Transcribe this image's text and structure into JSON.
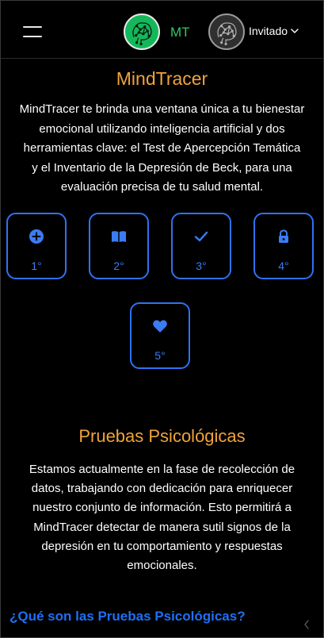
{
  "header": {
    "brand_abbr": "MT",
    "user_label": "Invitado",
    "icons": {
      "menu": "hamburger-icon",
      "brand_logo": "brain-circuit-logo",
      "user_avatar": "brain-circuit-avatar",
      "user_dropdown": "chevron-down-icon"
    }
  },
  "hero": {
    "title": "MindTracer",
    "description": "MindTracer te brinda una ventana única a tu bienestar emocional utilizando inteligencia artificial y dos herramientas clave: el Test de Apercepción Temática y el Inventario de la Depresión de Beck, para una evaluación precisa de tu salud mental."
  },
  "steps": [
    {
      "label": "1°",
      "icon": "plus-circle-icon"
    },
    {
      "label": "2°",
      "icon": "book-open-icon"
    },
    {
      "label": "3°",
      "icon": "check-icon"
    },
    {
      "label": "4°",
      "icon": "lock-icon"
    },
    {
      "label": "5°",
      "icon": "heart-icon"
    }
  ],
  "tests": {
    "title": "Pruebas Psicológicas",
    "description": "Estamos actualmente en la fase de recolección de datos, trabajando con dedicación para enriquecer nuestro conjunto de información. Esto permitirá a MindTracer detectar de manera sutil signos de la depresión en tu comportamiento y respuestas emocionales.",
    "question": "¿Qué son las Pruebas Psicológicas?"
  },
  "colors": {
    "background": "#000000",
    "accent_orange": "#f0a33b",
    "accent_blue": "#2f72f3",
    "brand_green": "#32c766"
  }
}
